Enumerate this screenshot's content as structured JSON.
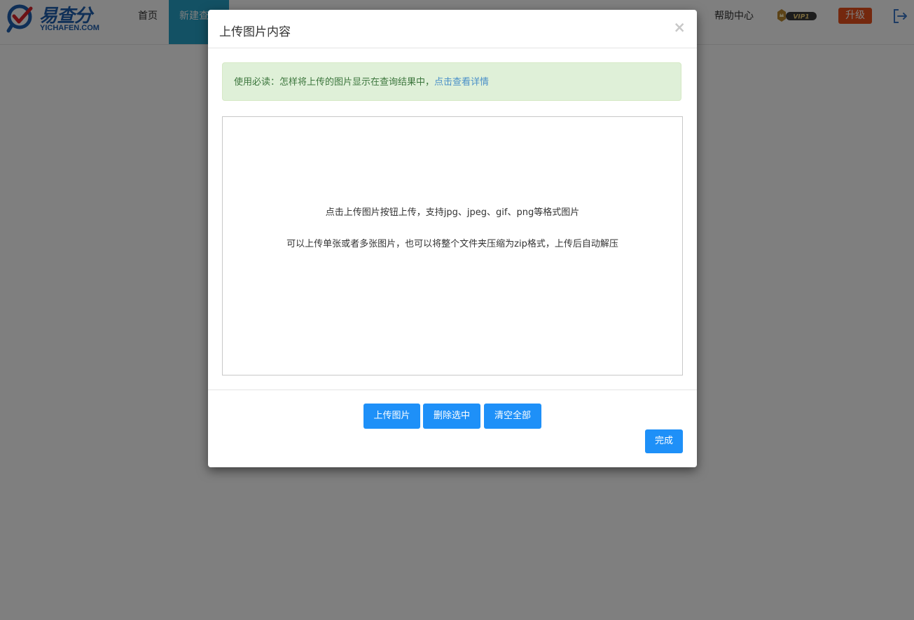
{
  "navbar": {
    "logo_text": "易查分",
    "logo_sub": "YICHAFEN.COM",
    "items": {
      "home": "首页",
      "new_query": "新建查询",
      "help": "帮助中心"
    },
    "vip_label": "VIP1",
    "upgrade_label": "升级"
  },
  "modal": {
    "title": "上传图片内容",
    "close_symbol": "×",
    "alert": {
      "text": "使用必读：怎样将上传的图片显示在查询结果中，",
      "link": "点击查看详情"
    },
    "upload_hints": [
      "点击上传图片按钮上传，支持jpg、jpeg、gif、png等格式图片",
      "可以上传单张或者多张图片，也可以将整个文件夹压缩为zip格式，上传后自动解压"
    ],
    "buttons": {
      "upload": "上传图片",
      "delete_selected": "删除选中",
      "clear_all": "清空全部",
      "done": "完成"
    }
  },
  "colors": {
    "nav_active": "#27a3c8",
    "upgrade": "#e8501c",
    "primary_button": "#1e90f8",
    "alert_bg": "#dff0d8",
    "alert_text": "#3c763d",
    "link": "#4a90c8"
  },
  "icons": {
    "logo": "yichafen-logo-icon",
    "vip": "vip-crown-icon",
    "logout": "logout-icon",
    "close": "close-icon"
  }
}
